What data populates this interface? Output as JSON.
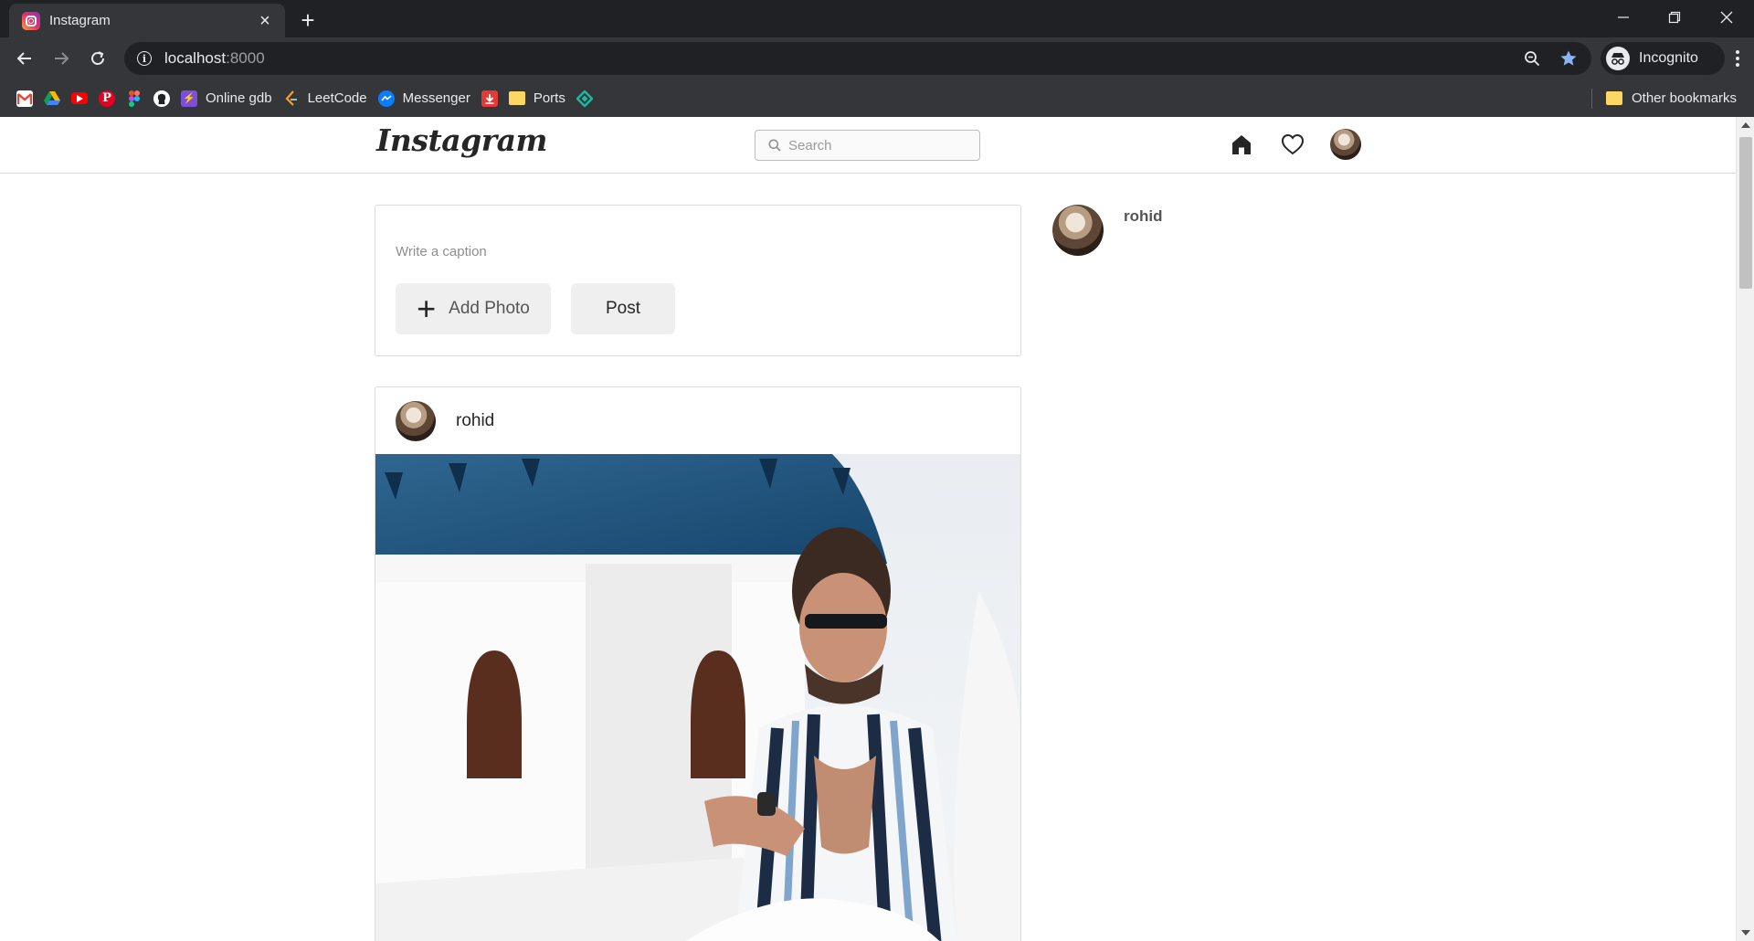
{
  "browser": {
    "tab_title": "Instagram",
    "tab_close": "×",
    "new_tab": "+",
    "url_host": "localhost",
    "url_port": ":8000",
    "profile_label": "Incognito",
    "bookmarks": [
      {
        "label": "",
        "icon": "gmail-icon",
        "color": "#ffffff"
      },
      {
        "label": "",
        "icon": "google-drive-icon",
        "color": "#1fa463"
      },
      {
        "label": "",
        "icon": "youtube-icon",
        "color": "#ff0000"
      },
      {
        "label": "",
        "icon": "pinterest-icon",
        "color": "#e60023"
      },
      {
        "label": "",
        "icon": "figma-icon",
        "color": "#f24e1e"
      },
      {
        "label": "",
        "icon": "github-icon",
        "color": "#ffffff"
      },
      {
        "label": "Online gdb",
        "icon": "onlinegdb-icon",
        "color": "#7b4fd6"
      },
      {
        "label": "LeetCode",
        "icon": "leetcode-icon",
        "color": "#ffa116"
      },
      {
        "label": "Messenger",
        "icon": "messenger-icon",
        "color": "#0a7cff"
      },
      {
        "label": "",
        "icon": "download-icon",
        "color": "#e53935"
      },
      {
        "label": "Ports",
        "icon": "folder-icon",
        "color": "#fdd663"
      },
      {
        "label": "",
        "icon": "diamond-icon",
        "color": "#1db9a0"
      }
    ],
    "other_bookmarks": "Other bookmarks"
  },
  "header": {
    "logo": "Instagram",
    "search_placeholder": "Search"
  },
  "composer": {
    "caption_placeholder": "Write a caption",
    "add_photo_label": "Add Photo",
    "add_photo_symbol": "+",
    "post_label": "Post"
  },
  "post": {
    "username": "rohid"
  },
  "sidebar": {
    "username": "rohid"
  },
  "colors": {
    "chrome_dark": "#202124",
    "chrome_toolbar": "#35363a",
    "border": "#dbdbdb",
    "text": "#262626"
  }
}
